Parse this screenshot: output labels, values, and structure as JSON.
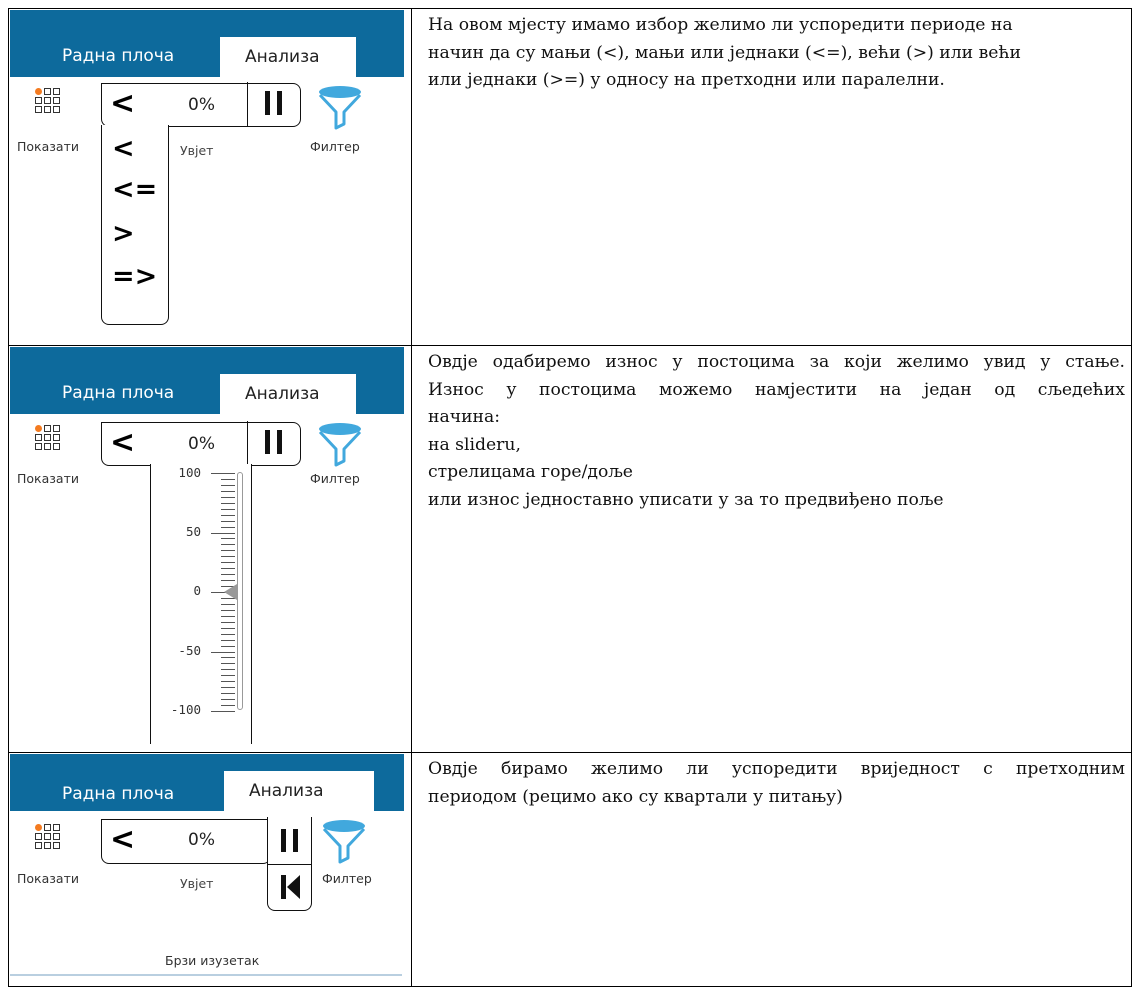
{
  "ribbon": {
    "tab_dashboard": "Радна плоча",
    "tab_analysis": "Анализа",
    "show_label": "Показати",
    "condition_label": "Увјет",
    "filter_label": "Филтер",
    "percent_value": "0%",
    "less_than_symbol": "<",
    "quick_exception_label": "Брзи изузетак"
  },
  "operators": [
    "<",
    "<",
    "<=",
    ">",
    "=>"
  ],
  "slider": {
    "ticks": [
      "100",
      "50",
      "0",
      "-50",
      "-100"
    ],
    "value": 0
  },
  "colors": {
    "accent_blue": "#0d6a9c",
    "indicator_orange": "#f47b20",
    "funnel_blue": "#41a8dd"
  },
  "icons": [
    "apps-grid-icon",
    "filter-funnel-icon",
    "pause-icon",
    "skip-back-icon"
  ],
  "rows": [
    {
      "text_lines": [
        "На овом мјесту имамо избор желимо ли успоредити периоде на",
        "начин да су мањи (<), мањи или једнаки (<=), већи (>) или већи",
        "или једнаки (>=) у односу на претходни или паралелни."
      ]
    },
    {
      "text_lines": [
        "Овдје одабиремо износ у постоцима за који желимо увид у стање.",
        "Износ у постоцима можемо намјестити на један од сљедећих",
        "начина:",
        "на slideru,",
        "стрелицама горе/доље",
        "или износ једноставно уписати у за то предвиђено поље"
      ]
    },
    {
      "text_lines": [
        "Овдје бирамо желимо ли успоредити вриједност с претходним",
        "периодом (рецимо ако су квартали у питању)"
      ]
    }
  ]
}
